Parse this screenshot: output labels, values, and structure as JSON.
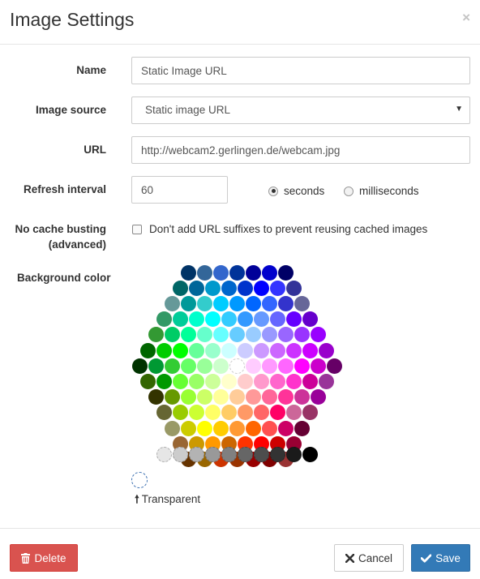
{
  "dialog": {
    "title": "Image Settings",
    "close_label": "×"
  },
  "form": {
    "name": {
      "label": "Name",
      "value": "Static Image URL"
    },
    "image_source": {
      "label": "Image source",
      "selected": "Static image URL"
    },
    "url": {
      "label": "URL",
      "value": "http://webcam2.gerlingen.de/webcam.jpg"
    },
    "refresh_interval": {
      "label": "Refresh interval",
      "value": "60",
      "units": [
        {
          "label": "seconds",
          "checked": true
        },
        {
          "label": "milliseconds",
          "checked": false
        }
      ]
    },
    "no_cache_busting": {
      "label_line1": "No cache busting",
      "label_line2": "(advanced)",
      "checkbox_label": "Don't add URL suffixes to prevent reusing cached images",
      "checked": false
    },
    "background_color": {
      "label": "Background color",
      "transparent_label": "Transparent",
      "hex_rows": [
        [
          "#003366",
          "#336699",
          "#3366CC",
          "#003399",
          "#000099",
          "#0000CC",
          "#000066"
        ],
        [
          "#006666",
          "#006699",
          "#0099CC",
          "#0066CC",
          "#0033CC",
          "#0000FF",
          "#3333FF",
          "#333399"
        ],
        [
          "#669999",
          "#009999",
          "#33CCCC",
          "#00CCFF",
          "#0099FF",
          "#0066FF",
          "#3366FF",
          "#3333CC",
          "#666699"
        ],
        [
          "#339966",
          "#00CC99",
          "#00FFCC",
          "#00FFFF",
          "#33CCFF",
          "#3399FF",
          "#6699FF",
          "#6666FF",
          "#6600FF",
          "#6600CC"
        ],
        [
          "#339933",
          "#00CC66",
          "#00FF99",
          "#66FFCC",
          "#66FFFF",
          "#66CCFF",
          "#99CCFF",
          "#9999FF",
          "#9966FF",
          "#9933FF",
          "#9900FF"
        ],
        [
          "#006600",
          "#00CC00",
          "#00FF00",
          "#66FF99",
          "#99FFCC",
          "#CCFFFF",
          "#CCCCFF",
          "#CC99FF",
          "#CC66FF",
          "#CC33FF",
          "#CC00FF",
          "#9900CC"
        ],
        [
          "#003300",
          "#009933",
          "#33CC33",
          "#66FF66",
          "#99FF99",
          "#CCFFCC",
          "#FFFFFF",
          "#FFCCFF",
          "#FF99FF",
          "#FF66FF",
          "#FF00FF",
          "#CC00CC",
          "#660066"
        ],
        [
          "#336600",
          "#009900",
          "#66FF33",
          "#99FF66",
          "#CCFF99",
          "#FFFFCC",
          "#FFCCCC",
          "#FF99CC",
          "#FF66CC",
          "#FF33CC",
          "#CC0099",
          "#993399"
        ],
        [
          "#333300",
          "#669900",
          "#99FF33",
          "#CCFF66",
          "#FFFF99",
          "#FFCC99",
          "#FF9999",
          "#FF6699",
          "#FF3399",
          "#CC3399",
          "#990099"
        ],
        [
          "#666633",
          "#99CC00",
          "#CCFF33",
          "#FFFF66",
          "#FFCC66",
          "#FF9966",
          "#FF6666",
          "#FF0066",
          "#CC6699",
          "#993366"
        ],
        [
          "#999966",
          "#CCCC00",
          "#FFFF00",
          "#FFCC00",
          "#FF9933",
          "#FF6600",
          "#FF5050",
          "#CC0066",
          "#660033"
        ],
        [
          "#996633",
          "#CC9900",
          "#FF9900",
          "#CC6600",
          "#FF3300",
          "#FF0000",
          "#CC0000",
          "#990033"
        ],
        [
          "#663300",
          "#996600",
          "#CC3300",
          "#993300",
          "#990000",
          "#800000",
          "#993333"
        ]
      ],
      "gray_row": [
        "#E6E6E6",
        "#CCCCCC",
        "#B3B3B3",
        "#999999",
        "#808080",
        "#666666",
        "#4D4D4D",
        "#333333",
        "#1A1A1A",
        "#000000"
      ]
    }
  },
  "footer": {
    "delete_label": "Delete",
    "cancel_label": "Cancel",
    "save_label": "Save"
  }
}
